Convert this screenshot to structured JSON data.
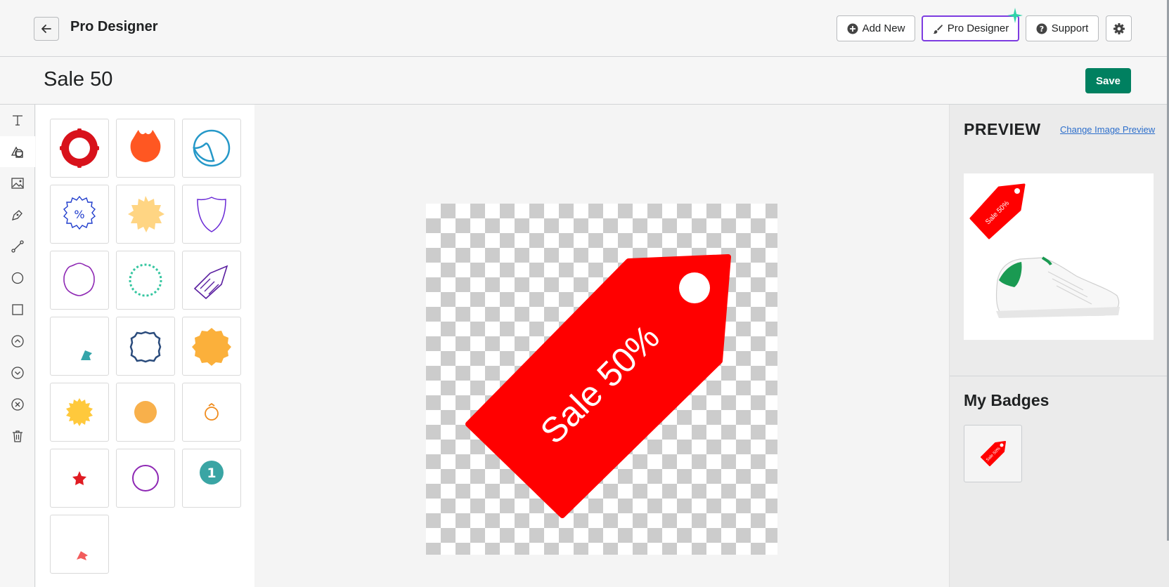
{
  "header": {
    "back_icon": "arrow-left-icon",
    "title": "Pro Designer",
    "buttons": {
      "add_new": "Add New",
      "pro_designer": "Pro Designer",
      "support": "Support"
    },
    "settings_icon": "gear-icon"
  },
  "badge": {
    "name": "Sale 50",
    "save_label": "Save"
  },
  "tools": [
    "text-tool-icon",
    "shapes-tool-icon",
    "image-tool-icon",
    "pen-tool-icon",
    "path-tool-icon",
    "circle-tool-icon",
    "square-tool-icon",
    "bring-forward-icon",
    "send-backward-icon",
    "deselect-icon",
    "trash-icon"
  ],
  "shapes": [
    "red-ring-badge",
    "orange-crown-badge",
    "blue-peel-sticker",
    "blue-percent-seal",
    "yellow-starburst",
    "purple-shield",
    "purple-wavy-circle",
    "teal-zigzag-circle",
    "purple-chevron-tag",
    "teal-ribbon-flag",
    "navy-wavy-circle",
    "orange-wavy-seal",
    "yellow-sun-burst",
    "orange-dot",
    "orange-ring-outline",
    "red-star",
    "purple-circle-outline",
    "teal-number-one-badge",
    "pink-ribbon-flag"
  ],
  "canvas": {
    "tag_text": "Sale 50%",
    "tag_color": "#ff0000"
  },
  "preview": {
    "title": "PREVIEW",
    "change_link": "Change Image Preview",
    "mini_tag_text": "Sale 50%"
  },
  "my_badges": {
    "title": "My Badges",
    "item_text": "Sale 50%"
  },
  "colors": {
    "primary_green": "#008060",
    "accent_purple": "#7d3ce0",
    "badge_red": "#ff0000",
    "link_blue": "#2c6ecb"
  }
}
